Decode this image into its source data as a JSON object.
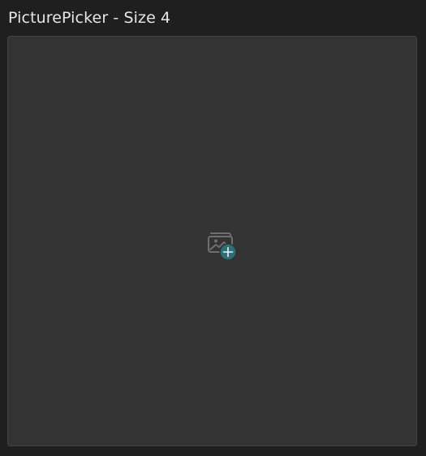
{
  "title": "PicturePicker - Size 4",
  "picker": {
    "icon": "add-image-icon",
    "icon_color": "#6f6f6f",
    "badge_color": "#2c6e78",
    "badge_glyph_color": "#e6f2f4"
  },
  "colors": {
    "background": "#1f1f1f",
    "panel": "#333333",
    "panel_border": "#454545",
    "title_text": "#e6e6e6"
  }
}
